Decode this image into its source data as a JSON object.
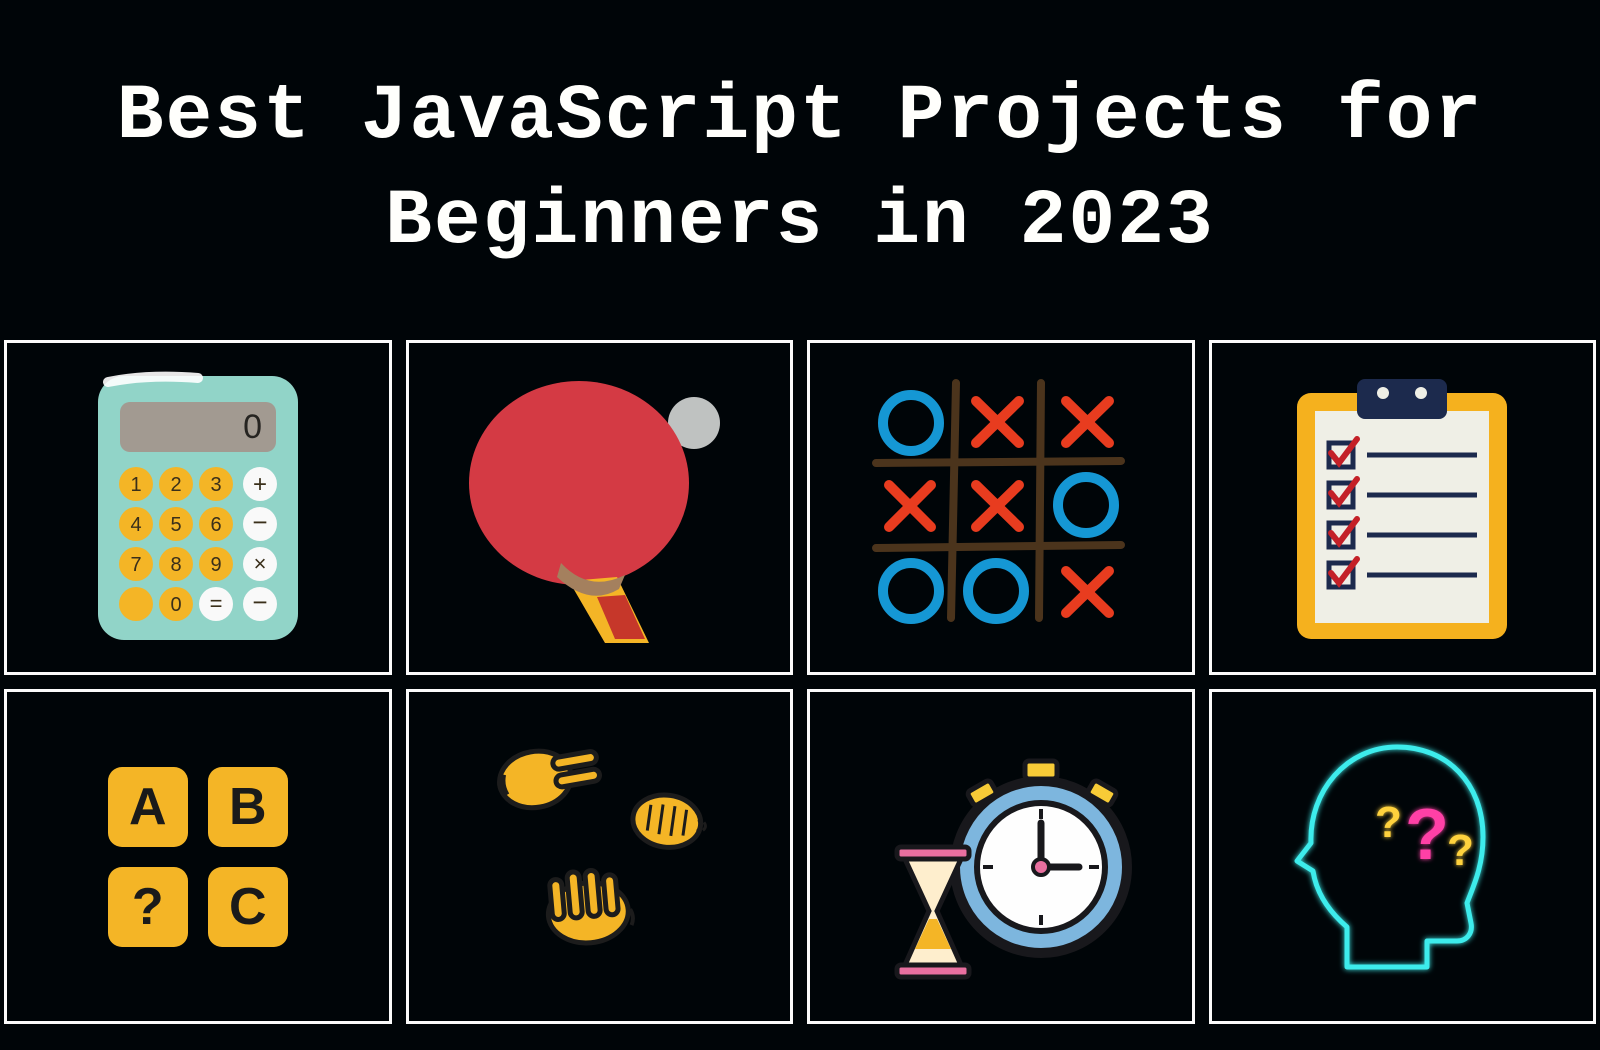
{
  "header": {
    "title": "Best JavaScript Projects for Beginners in 2023"
  },
  "projects": [
    {
      "id": "calculator",
      "label": "Calculator"
    },
    {
      "id": "pong",
      "label": "Pong Game"
    },
    {
      "id": "tic-tac-toe",
      "label": "Tic Tac Toe"
    },
    {
      "id": "todo-list",
      "label": "To-Do List"
    },
    {
      "id": "word-guess",
      "label": "Word Guessing Game"
    },
    {
      "id": "rock-paper-scissors",
      "label": "Rock Paper Scissors"
    },
    {
      "id": "timer",
      "label": "Countdown Timer"
    },
    {
      "id": "quiz",
      "label": "Quiz App"
    }
  ],
  "calculator": {
    "display": "0"
  },
  "word_guess": {
    "tiles": [
      "A",
      "B",
      "?",
      "C"
    ]
  },
  "colors": {
    "bg": "#000508",
    "border": "#fbfbfb",
    "calc_body": "#91d4c8",
    "accent_orange": "#f4b526",
    "paddle_red": "#d43a44",
    "ball_gray": "#bfc2c1",
    "grid_brown": "#4b341c",
    "o_blue": "#1597d4",
    "x_red": "#e83c1f",
    "clipboard": "#f5b11e",
    "paper": "#efefe6",
    "clip_dark": "#1c2a4d",
    "check_red": "#c42128",
    "clock_blue": "#7db6de",
    "clock_yellow": "#f7cb37",
    "hourglass_pink": "#e86f9f",
    "neon_cyan": "#3decec",
    "neon_pink": "#ff3fa6",
    "neon_yellow": "#ffd23e"
  }
}
